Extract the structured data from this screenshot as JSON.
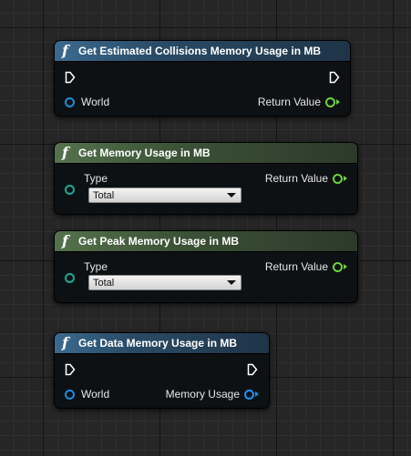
{
  "nodes": [
    {
      "title": "Get Estimated Collisions Memory Usage in MB",
      "icon": "function-icon",
      "header_color": "#3b6a8f",
      "inputs": [
        "World"
      ],
      "outputs": [
        "Return Value"
      ]
    },
    {
      "title": "Get Memory Usage in MB",
      "icon": "function-icon",
      "header_color": "#54724c",
      "input_label": "Type",
      "select_value": "Total",
      "outputs": [
        "Return Value"
      ]
    },
    {
      "title": "Get Peak Memory Usage in MB",
      "icon": "function-icon",
      "header_color": "#54724c",
      "input_label": "Type",
      "select_value": "Total",
      "outputs": [
        "Return Value"
      ]
    },
    {
      "title": "Get Data Memory Usage in MB",
      "icon": "function-icon",
      "header_color": "#3b6a8f",
      "inputs": [
        "World"
      ],
      "outputs": [
        "Memory Usage"
      ]
    }
  ],
  "colors": {
    "world_pin": "#1a8fe0",
    "int_pin": "#6dd43a",
    "enum_pin": "#1aa89a",
    "exec_pin": "#ffffff"
  }
}
